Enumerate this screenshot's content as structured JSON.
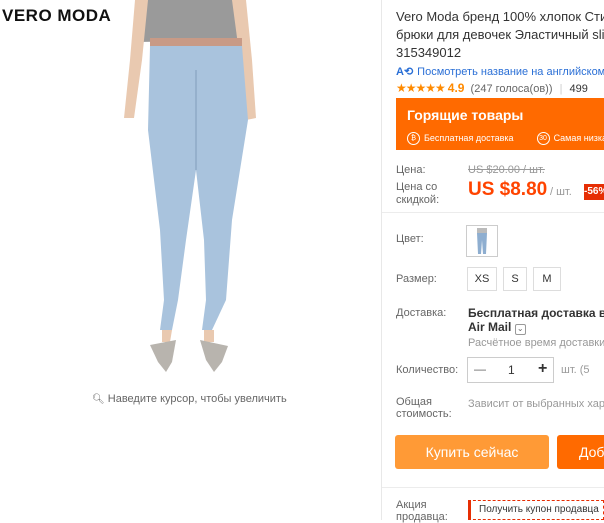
{
  "brand": "VERO MODA",
  "zoom_hint": "Наведите курсор, чтобы увеличить",
  "title_lines": [
    "Vero Moda бренд 100% хлопок Сти",
    "брюки для девочек Эластичный sli",
    "315349012"
  ],
  "translate_link": "Посмотреть название на английском",
  "rating": {
    "stars": "★★★★★",
    "value": "4.9",
    "votes": "(247 голоса(ов))",
    "orders": "499"
  },
  "hot_deals": {
    "title": "Горящие товары",
    "free_shipping": "Бесплатная доставка",
    "icon30": "30",
    "lowest": "Самая низка"
  },
  "price": {
    "label": "Цена:",
    "original": "US $20.00 / шт.",
    "discount_label": "Цена со скидкой:",
    "sale": "US $8.80",
    "unit": "/ шт.",
    "discount_badge": "-56%"
  },
  "color": {
    "label": "Цвет:"
  },
  "size": {
    "label": "Размер:",
    "options": [
      "XS",
      "S",
      "M"
    ]
  },
  "shipping": {
    "label": "Доставка:",
    "line1": "Бесплатная доставка в Ru",
    "line2": "Air Mail",
    "estimate": "Расчётное время доставки"
  },
  "quantity": {
    "label": "Количество:",
    "minus": "—",
    "value": "1",
    "plus": "+",
    "unit": "шт. (5"
  },
  "total": {
    "label1": "Общая",
    "label2": "стоимость:",
    "value": "Зависит от выбранных хара"
  },
  "buttons": {
    "buy_now": "Купить сейчас",
    "add_cart": "Доб"
  },
  "promo": {
    "label1": "Акция",
    "label2": "продавца:",
    "coupon": "Получить купон продавца"
  },
  "colors": {
    "accent": "#ff6a00",
    "buy": "#ff9a36",
    "link": "#2a6fd6",
    "badge": "#e62e04"
  }
}
